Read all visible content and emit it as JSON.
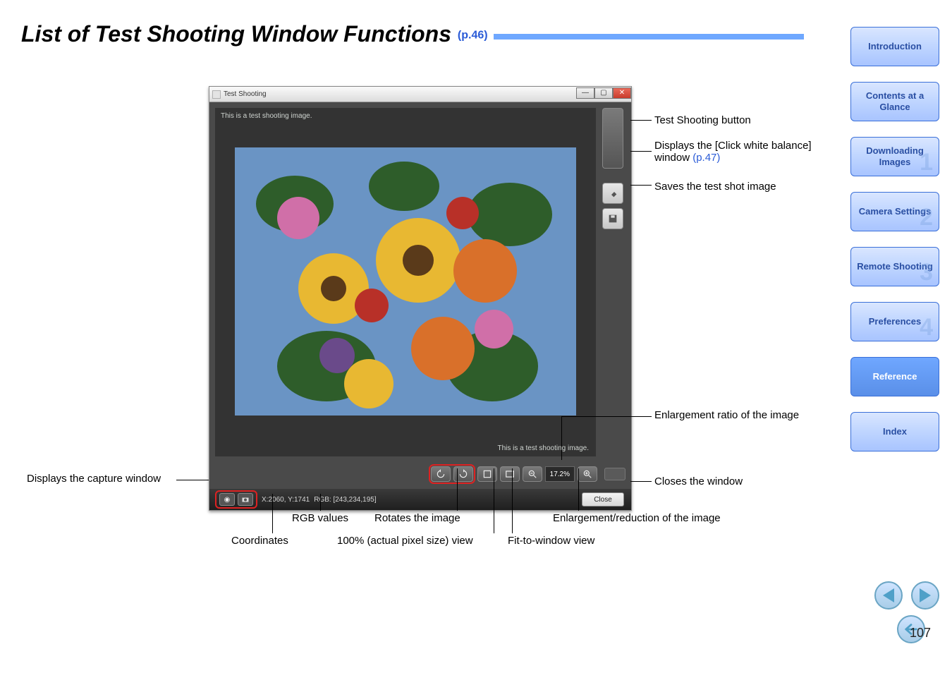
{
  "page": {
    "title": "List of Test Shooting Window Functions",
    "title_ref": "(p.46)",
    "page_number": "107"
  },
  "nav": {
    "introduction": "Introduction",
    "contents": "Contents at a Glance",
    "downloading": "Downloading Images",
    "camera_settings": "Camera Settings",
    "remote_shooting": "Remote Shooting",
    "preferences": "Preferences",
    "reference": "Reference",
    "index": "Index"
  },
  "window": {
    "title": "Test Shooting",
    "img_label_top": "This is a test shooting image.",
    "img_label_bottom": "This is a test shooting image.",
    "ratio": "17.2%",
    "status": {
      "coords": "X:2060, Y:1741",
      "rgb": "RGB: [243,234,195]"
    },
    "close_label": "Close"
  },
  "callouts": {
    "test_shoot_btn": "Test Shooting button",
    "click_wb": "Displays the [Click white balance] window ",
    "click_wb_ref": "(p.47)",
    "save_shot": "Saves the test shot image",
    "ratio": "Enlargement ratio of the image",
    "close": "Closes the window",
    "capture_window": "Displays the capture window",
    "rgb": "RGB values",
    "rotate": "Rotates the image",
    "zoom": "Enlargement/reduction of the image",
    "coords": "Coordinates",
    "hundred": "100% (actual pixel size) view",
    "fit": "Fit-to-window view"
  }
}
